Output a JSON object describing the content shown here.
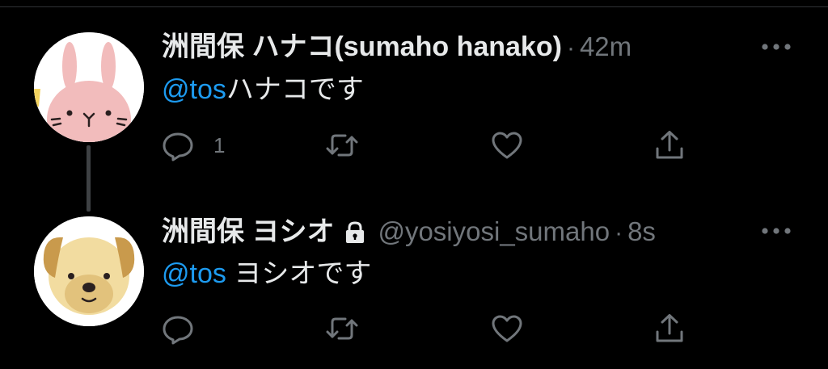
{
  "colors": {
    "background": "#000000",
    "text": "#e7e9ea",
    "secondary": "#71767b",
    "mention": "#1d9bf0"
  },
  "tweets": [
    {
      "display_name": "洲間保 ハナコ(sumaho hanako)",
      "handle": "",
      "dot": "·",
      "timestamp": "42m",
      "mention": "@tos",
      "text": "ハナコです",
      "reply_count": "1",
      "avatar_icon": "bunny-avatar",
      "protected": false
    },
    {
      "display_name": "洲間保 ヨシオ",
      "handle": "@yosiyosi_sumaho",
      "dot": "·",
      "timestamp": "8s",
      "mention": "@tos",
      "text": " ヨシオです",
      "reply_count": "",
      "avatar_icon": "puppy-avatar",
      "protected": true
    }
  ],
  "icons": {
    "more": "more-horizontal-icon",
    "reply": "reply-icon",
    "retweet": "retweet-icon",
    "like": "heart-icon",
    "share": "share-icon",
    "lock": "lock-icon"
  }
}
